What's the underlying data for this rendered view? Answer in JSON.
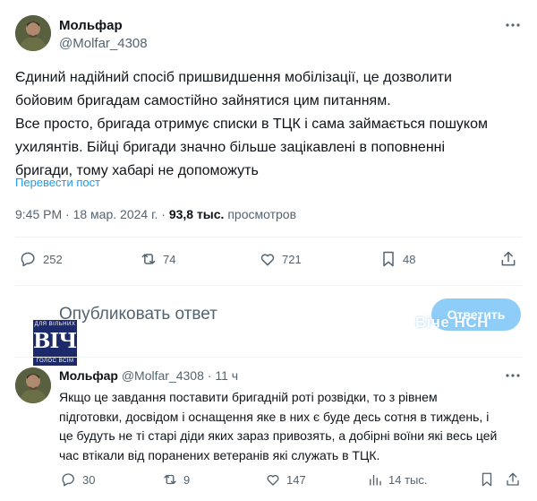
{
  "tweet": {
    "author_name": "Мольфар",
    "author_handle": "@Molfar_4308",
    "text_lines": [
      "Єдиний надійний спосіб пришвидшення мобілізації, це дозволити",
      "бойовим бригадам самостійно зайнятися цим питанням.",
      "Все просто, бригада отримує списки в ТЦК і сама займається пошуком",
      "ухилянтів. Бійці бригади значно більше зацікавлені в поповненні",
      "бригади, тому хабарі не допоможуть"
    ],
    "translate_label": "Перевести пост",
    "time": "9:45 PM",
    "date": "18 мар. 2024 г.",
    "views_count": "93,8 тыс.",
    "views_label": "просмотров",
    "separator": "·",
    "stats": {
      "replies": "252",
      "reposts": "74",
      "likes": "721",
      "bookmarks": "48"
    }
  },
  "compose": {
    "placeholder": "Опубликовать ответ",
    "button_label": "Ответить"
  },
  "logo": {
    "top": "ДЛЯ ВІЛЬНИХ",
    "main": "ВІЧЕ",
    "bottom": "ГОЛОС ВСІМ"
  },
  "watermark": "Віче НСН",
  "reply": {
    "author_name": "Мольфар",
    "author_handle": "@Molfar_4308",
    "time": "11 ч",
    "separator": "·",
    "text_lines": [
      "Якщо це завдання поставити бригадній роті розвідки, то з рівнем",
      "підготовки, досвідом і оснащення яке в них є буде десь сотня в тиждень, і",
      "це будуть не ті старі діди яких зараз привозять, а добірні воїни які весь цей",
      "час втікали від поранених ветеранів які служать в ТЦК."
    ],
    "stats": {
      "replies": "30",
      "reposts": "9",
      "likes": "147",
      "views": "14 тыс."
    }
  },
  "colors": {
    "accent": "#1d9bf0",
    "button_disabled": "#8ecdf8",
    "secondary_text": "#536471",
    "primary_text": "#0f1419",
    "divider": "#eff3f4",
    "logo_bg": "#1c2a6b"
  },
  "icons": [
    "avatar-photo",
    "more-icon",
    "reply-icon",
    "repost-icon",
    "like-icon",
    "bookmark-icon",
    "share-icon",
    "views-icon"
  ]
}
